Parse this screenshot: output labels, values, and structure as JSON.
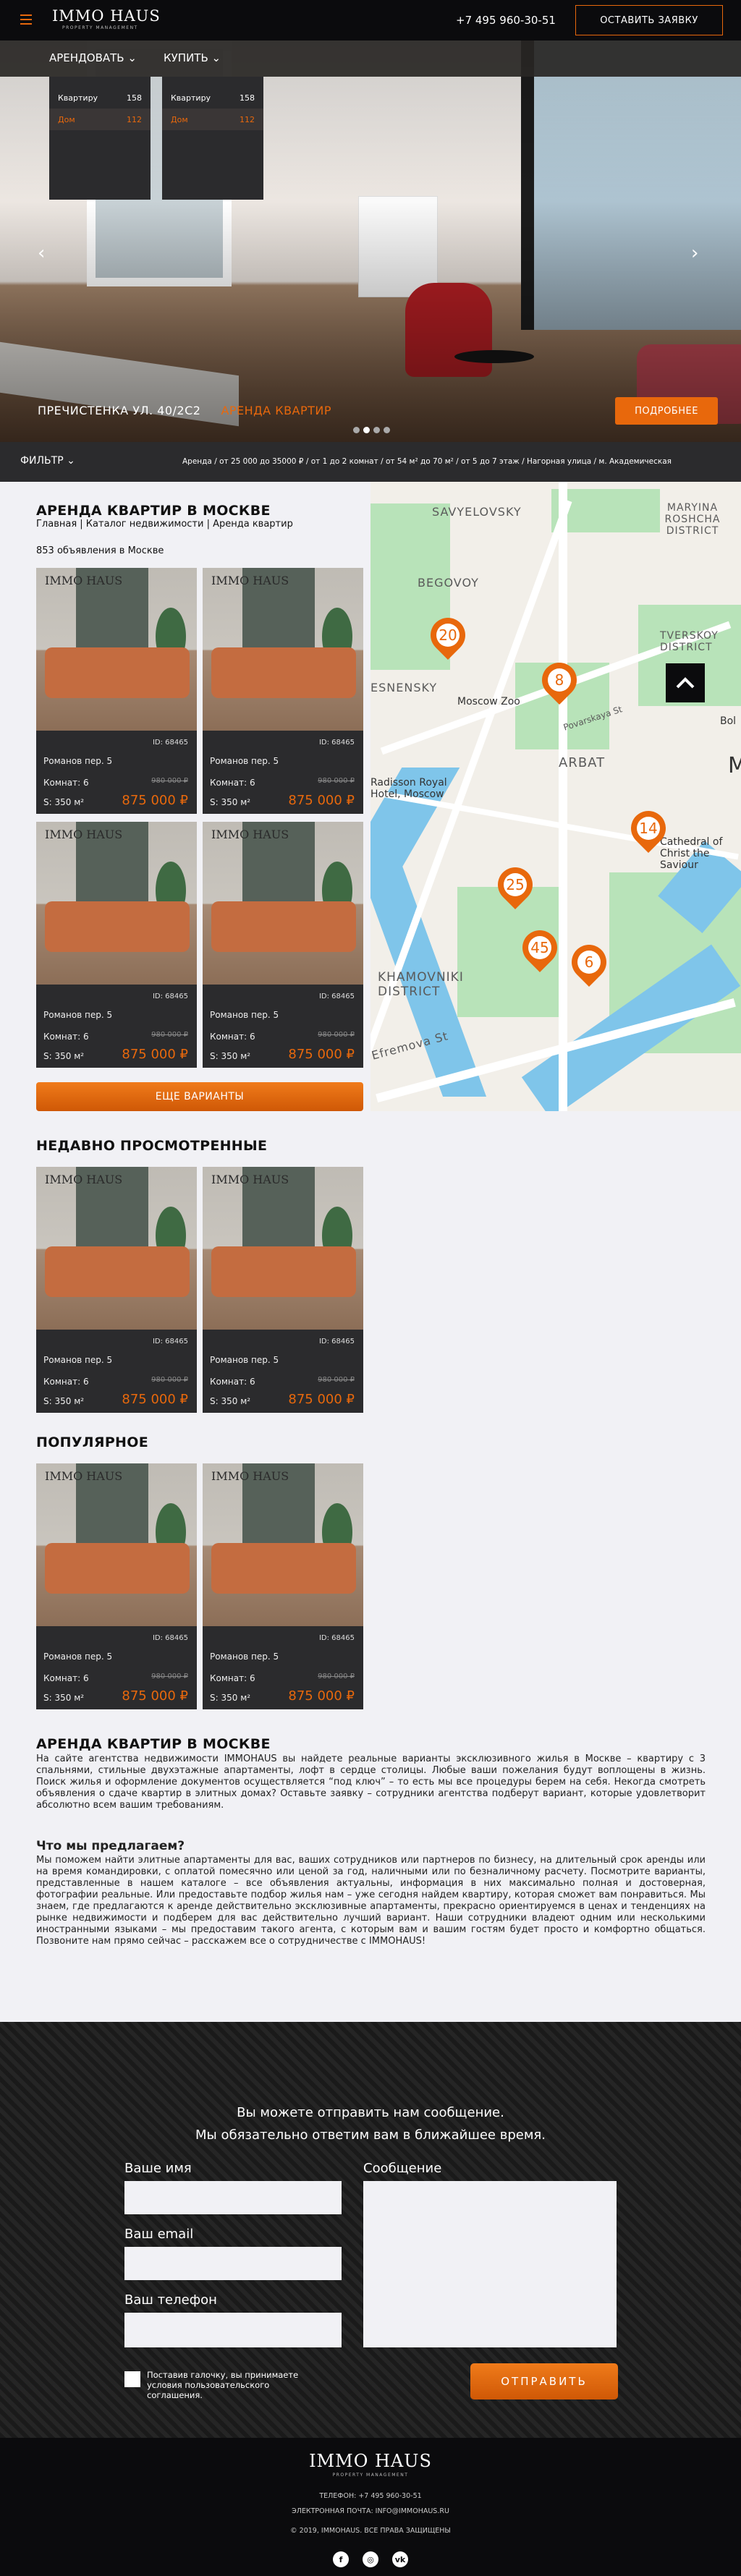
{
  "header": {
    "logo_main": "IMMO HAUS",
    "logo_sub": "PROPERTY MANAGEMENT",
    "phone": "+7 495 960-30-51",
    "cta": "ОСТАВИТЬ ЗАЯВКУ"
  },
  "nav": {
    "rent": "АРЕНДОВАТЬ",
    "buy": "КУПИТЬ",
    "rent_menu": [
      {
        "label": "Квартиру",
        "count": "158"
      },
      {
        "label": "Дом",
        "count": "112"
      }
    ],
    "buy_menu": [
      {
        "label": "Квартиру",
        "count": "158"
      },
      {
        "label": "Дом",
        "count": "112"
      }
    ]
  },
  "hero": {
    "address": "ПРЕЧИСТЕНКА УЛ. 40/2С2",
    "type": "АРЕНДА КВАРТИР",
    "more": "ПОДРОБНЕЕ",
    "prev": "‹",
    "next": "›",
    "active_slide": 2,
    "slides_count": 4
  },
  "filter": {
    "label": "ФИЛЬТР",
    "summary": "Аренда / от 25 000 до 35000 ₽ / от 1 до 2 комнат / от 54 м² до 70 м² / от 5 до 7 этаж / Нагорная улица / м. Академическая"
  },
  "listing": {
    "title": "АРЕНДА КВАРТИР В МОСКВЕ",
    "breadcrumb": "Главная | Каталог недвижимости | Аренда квартир",
    "count": "853 объявления в Москве",
    "more": "ЕЩЕ ВАРИАНТЫ"
  },
  "card": {
    "brand": "IMMO HAUS",
    "id": "ID: 68465",
    "address": "Романов пер. 5",
    "rooms": "Комнат: 6",
    "area": "S: 350 м²",
    "old_price": "980 000 ₽",
    "price": "875 000 ₽"
  },
  "map": {
    "labels": [
      "SAVYELOVSKY",
      "MARYINA ROSHCHA DISTRICT",
      "BEGOVOY",
      "TVERSKOY DISTRICT",
      "ESNENSKY",
      "Moscow Zoo",
      "Povarskaya St",
      "ARBAT",
      "Radisson Royal Hotel, Moscow",
      "Cathedral of Christ the Saviour",
      "KHAMOVNIKI DISTRICT",
      "Efremova St",
      "Bol",
      "M"
    ],
    "pins": [
      "20",
      "8",
      "14",
      "25",
      "45",
      "6"
    ]
  },
  "recent": {
    "title": "НЕДАВНО ПРОСМОТРЕННЫЕ"
  },
  "popular": {
    "title": "ПОПУЛЯРНОЕ"
  },
  "about": {
    "title": "АРЕНДА КВАРТИР В МОСКВЕ",
    "p1": "На сайте агентства недвижимости IMMOHAUS вы найдете реальные варианты эксклюзивного жилья в Москве – квартиру с 3 спальнями, стильные двухэтажные апартаменты, лофт в сердце столицы. Любые ваши пожелания будут воплощены в жизнь. Поиск жилья и оформление документов осуществляется “под ключ” – то есть мы все процедуры берем на себя. Некогда смотреть объявления о сдаче квартир в элитных домах? Оставьте заявку – сотрудники агентства подберут вариант, которые удовлетворит абсолютно всем вашим требованиям.",
    "subtitle": "Что мы предлагаем?",
    "p2": "Мы поможем найти элитные апартаменты для вас, ваших сотрудников или партнеров по бизнесу, на длительный срок аренды или на время командировки, с оплатой помесячно или ценой за год, наличными или по безналичному расчету. Посмотрите варианты, представленные в нашем каталоге – все объявления актуальны, информация в них максимально полная и достоверная, фотографии реальные. Или предоставьте подбор жилья нам – уже сегодня найдем квартиру, которая сможет вам понравиться. Мы знаем, где предлагаются к аренде действительно эксклюзивные апартаменты, прекрасно ориентируемся в ценах и тенденциях на рынке недвижимости и подберем для вас действительно лучший вариант. Наши сотрудники владеют одним или несколькими иностранными языками – мы предоставим такого агента, с которым вам и вашим гостям будет просто и комфортно общаться. Позвоните нам прямо сейчас – расскажем все о сотрудничестве с IMMOHAUS!"
  },
  "contact": {
    "heading1": "Вы можете отправить нам сообщение.",
    "heading2": "Мы обязательно ответим вам в ближайшее время.",
    "name_label": "Ваше имя",
    "email_label": "Ваш email",
    "phone_label": "Ваш телефон",
    "message_label": "Сообщение",
    "agree": "Поставив галочку, вы принимаете условия пользовательского соглашения.",
    "send": "ОТПРАВИТЬ"
  },
  "footer": {
    "logo_main": "IMMO HAUS",
    "logo_sub": "PROPERTY MANAGEMENT",
    "phone": "ТЕЛЕФОН: +7 495 960-30-51",
    "email": "ЭЛЕКТРОННАЯ ПОЧТА: INFO@IMMOHAUS.RU",
    "copyright": "© 2019, IMMOHAUS. ВСЕ ПРАВА ЗАЩИЩЕНЫ",
    "social": [
      "facebook-icon",
      "instagram-icon",
      "vk-icon"
    ]
  },
  "colors": {
    "accent": "#e8680c",
    "dark": "#2b2b2d",
    "black": "#0b0b0d",
    "bg": "#f1f1f5"
  }
}
